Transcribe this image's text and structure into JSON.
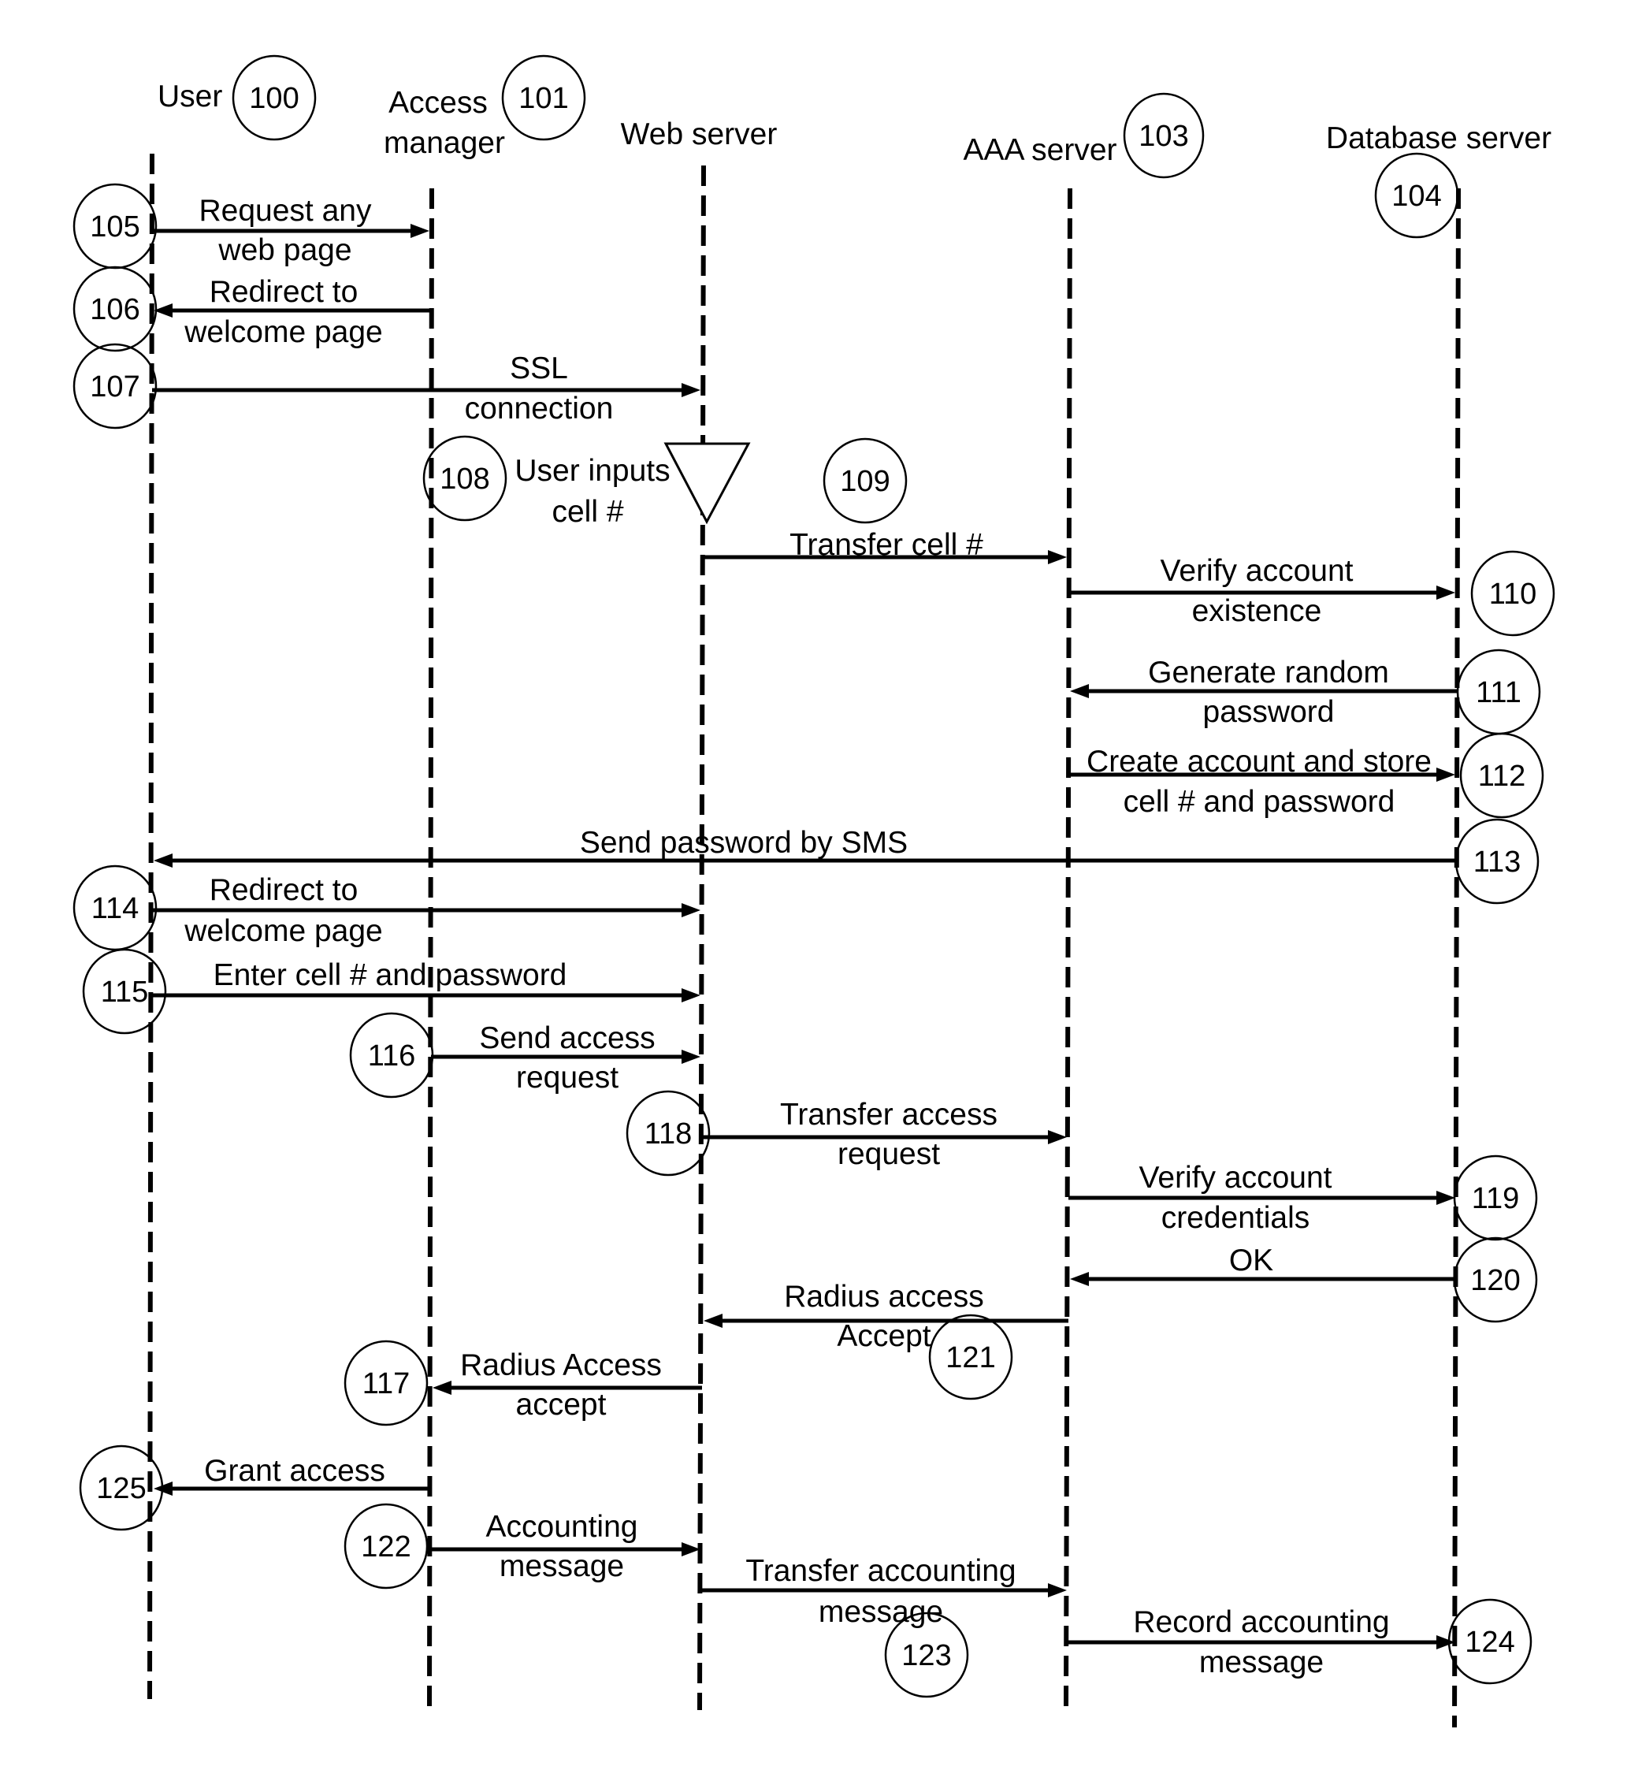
{
  "participants": [
    {
      "id": "user",
      "label": "User",
      "ref": "100"
    },
    {
      "id": "access-manager",
      "label": "Access manager",
      "ref": "101"
    },
    {
      "id": "web-server",
      "label": "Web server",
      "ref": ""
    },
    {
      "id": "aaa-server",
      "label": "AAA server",
      "ref": "103"
    },
    {
      "id": "database-server",
      "label": "Database server",
      "ref": "104"
    }
  ],
  "messages": [
    {
      "ref": "105",
      "from": "user",
      "to": "access-manager",
      "lines": [
        "Request any",
        "web page"
      ]
    },
    {
      "ref": "106",
      "from": "access-manager",
      "to": "user",
      "lines": [
        "Redirect to",
        "welcome page"
      ]
    },
    {
      "ref": "107",
      "from": "user",
      "to": "web-server",
      "lines": [
        "SSL",
        "connection"
      ]
    },
    {
      "ref": "109",
      "from": "web-server",
      "to": "aaa-server",
      "lines": [
        "Transfer cell #"
      ]
    },
    {
      "ref": "110",
      "from": "aaa-server",
      "to": "database-server",
      "lines": [
        "Verify account",
        "existence"
      ]
    },
    {
      "ref": "111",
      "from": "database-server",
      "to": "aaa-server",
      "lines": [
        "Generate random",
        "password"
      ]
    },
    {
      "ref": "112",
      "from": "aaa-server",
      "to": "database-server",
      "lines": [
        "Create account and store",
        "cell # and password"
      ]
    },
    {
      "ref": "113",
      "from": "database-server",
      "to": "user",
      "lines": [
        "Send password by SMS"
      ]
    },
    {
      "ref": "114",
      "from": "user",
      "to": "web-server",
      "lines": [
        "Redirect to",
        "welcome page"
      ]
    },
    {
      "ref": "115",
      "from": "user",
      "to": "web-server",
      "lines": [
        "Enter cell # and password"
      ]
    },
    {
      "ref": "116",
      "from": "access-manager",
      "to": "web-server",
      "lines": [
        "Send access",
        "request"
      ]
    },
    {
      "ref": "118",
      "from": "web-server",
      "to": "aaa-server",
      "lines": [
        "Transfer access",
        "request"
      ]
    },
    {
      "ref": "119",
      "from": "aaa-server",
      "to": "database-server",
      "lines": [
        "Verify account",
        "credentials"
      ]
    },
    {
      "ref": "120",
      "from": "database-server",
      "to": "aaa-server",
      "lines": [
        "OK"
      ]
    },
    {
      "ref": "121",
      "from": "aaa-server",
      "to": "web-server",
      "lines": [
        "Radius access",
        "Accept"
      ]
    },
    {
      "ref": "117",
      "from": "web-server",
      "to": "access-manager",
      "lines": [
        "Radius Access",
        "accept"
      ]
    },
    {
      "ref": "125",
      "from": "access-manager",
      "to": "user",
      "lines": [
        "Grant access"
      ]
    },
    {
      "ref": "122",
      "from": "access-manager",
      "to": "web-server",
      "lines": [
        "Accounting",
        "message"
      ]
    },
    {
      "ref": "123",
      "from": "web-server",
      "to": "aaa-server",
      "lines": [
        "Transfer accounting",
        "message"
      ]
    },
    {
      "ref": "124",
      "from": "aaa-server",
      "to": "database-server",
      "lines": [
        "Record accounting",
        "message"
      ]
    }
  ],
  "notes": [
    {
      "ref": "108",
      "at": "web-server",
      "lines": [
        "User inputs",
        "cell #"
      ],
      "shape": "triangle-down"
    }
  ]
}
